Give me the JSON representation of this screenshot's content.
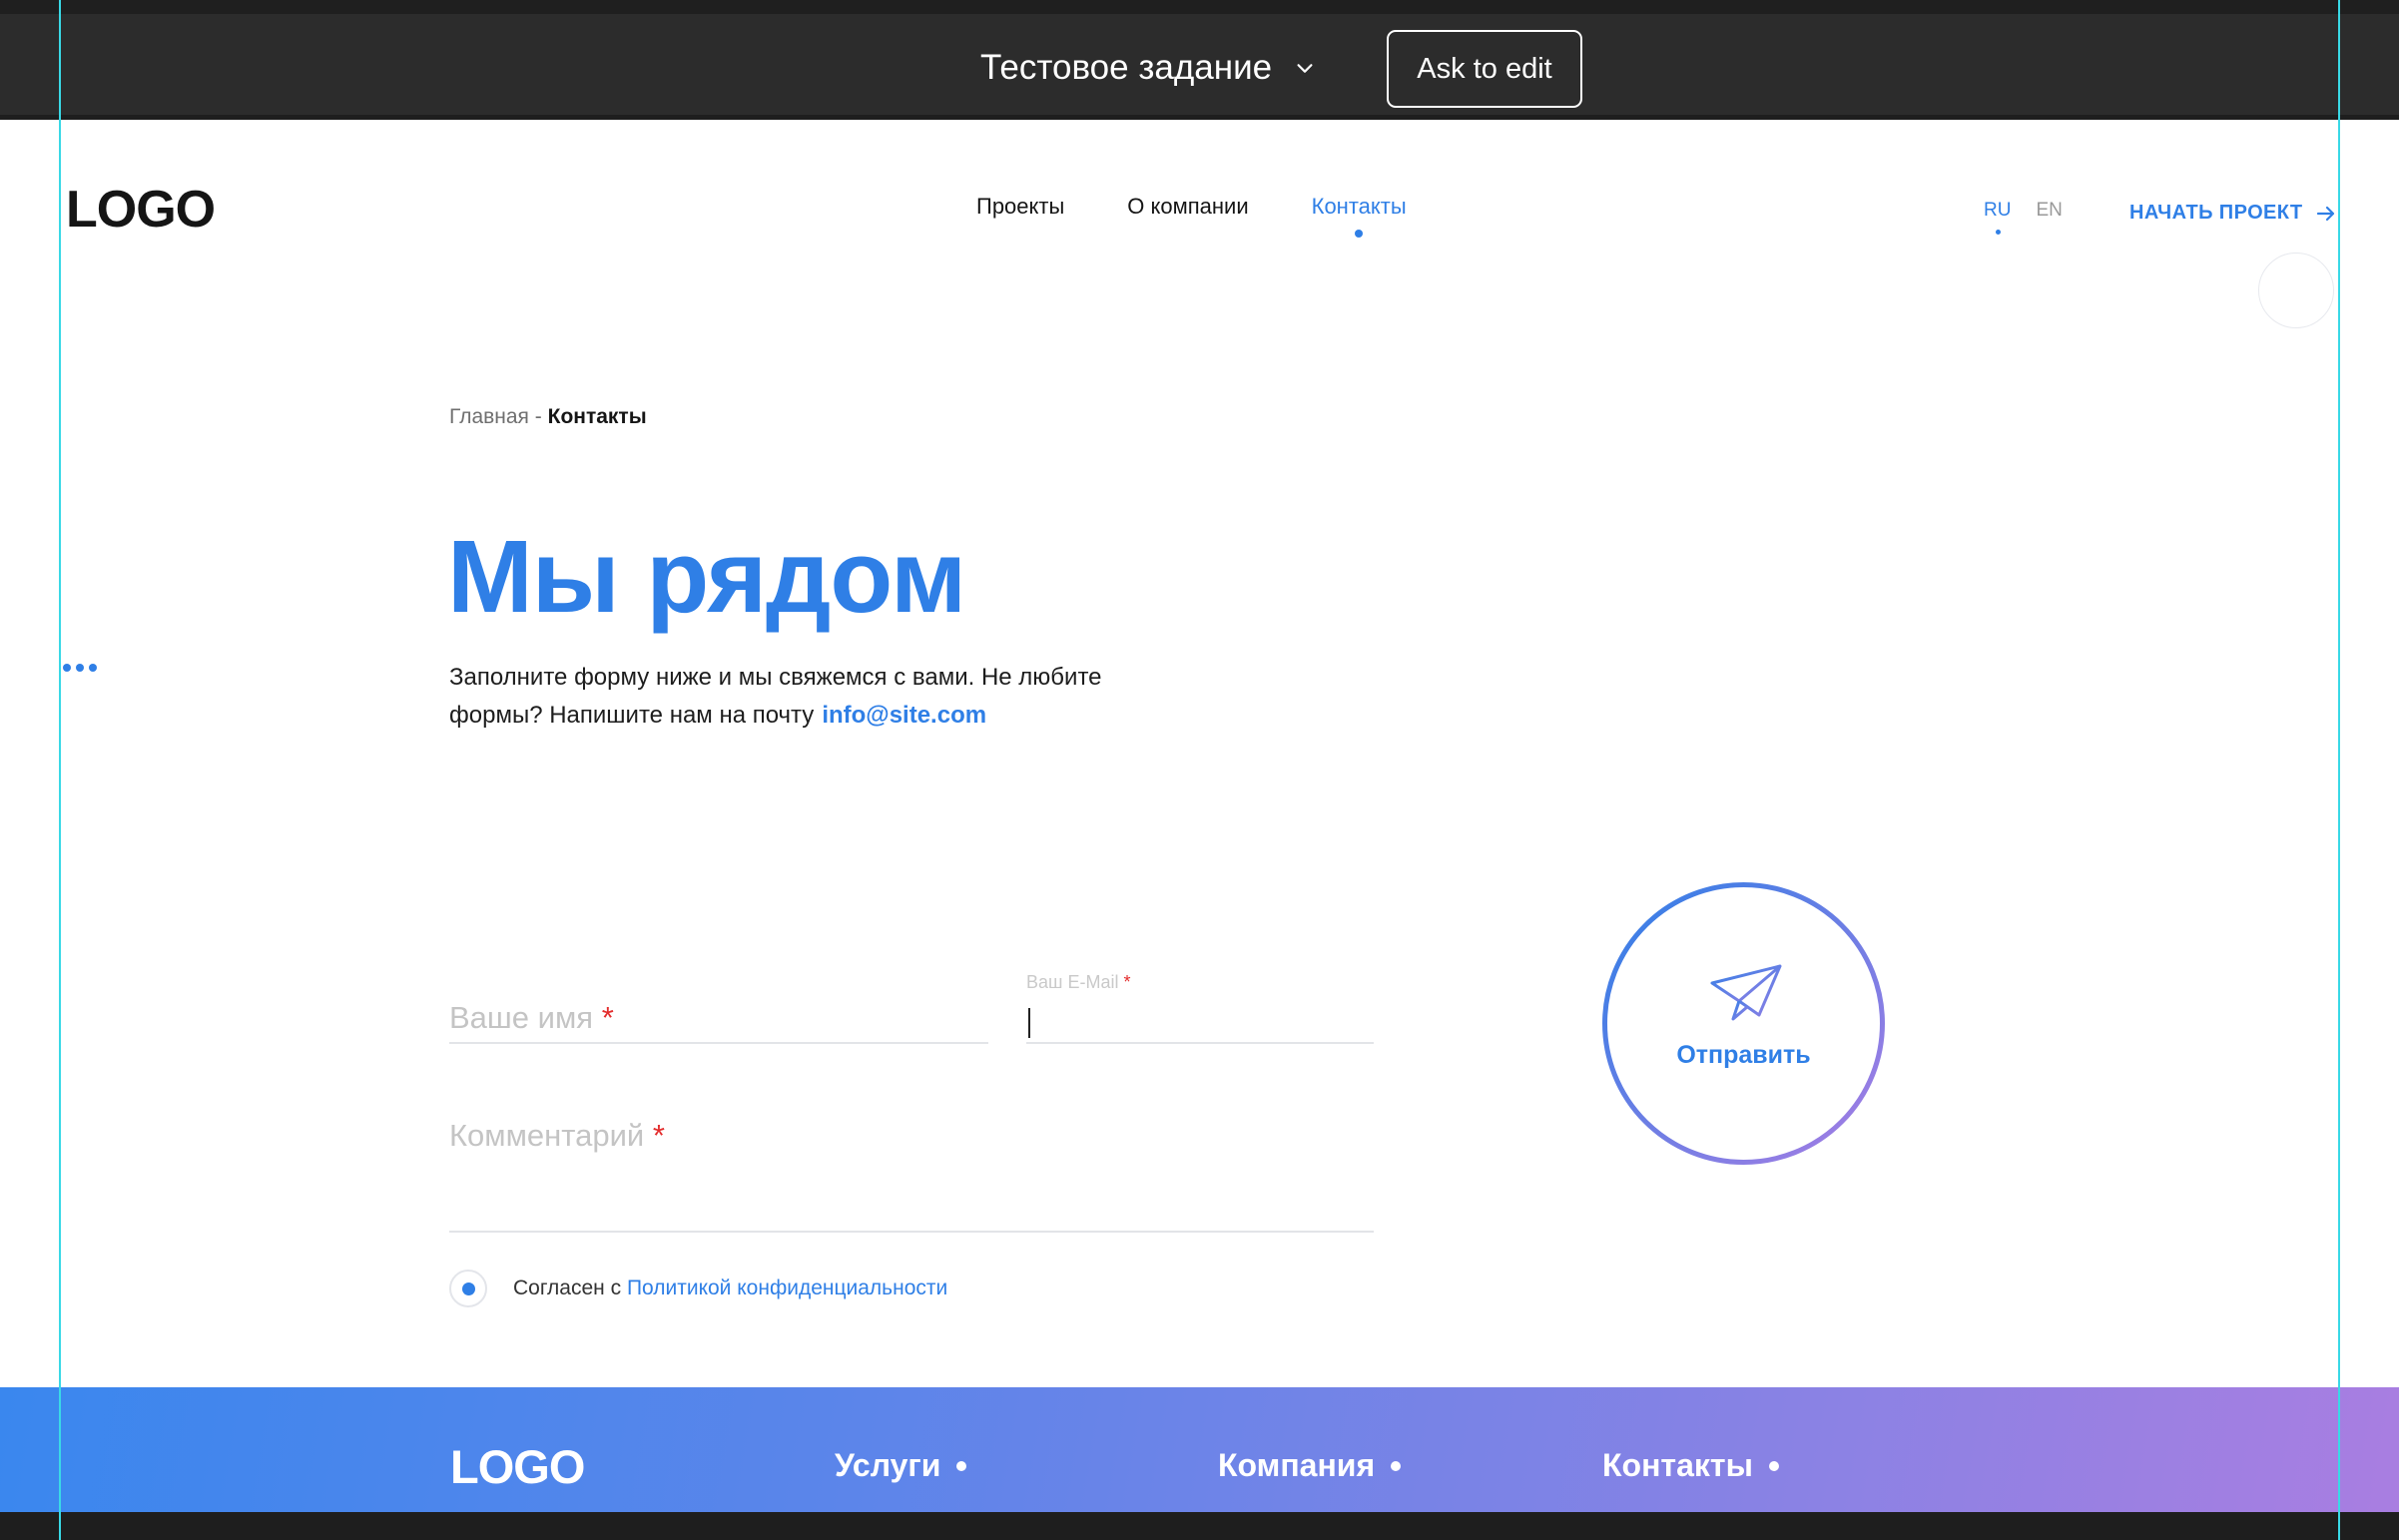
{
  "editor": {
    "file_title": "Тестовое задание",
    "ask_to_edit": "Ask to edit"
  },
  "header": {
    "logo": "LOGO",
    "nav": [
      {
        "label": "Проекты",
        "active": false
      },
      {
        "label": "О компании",
        "active": false
      },
      {
        "label": "Контакты",
        "active": true
      }
    ],
    "languages": [
      {
        "label": "RU",
        "active": true
      },
      {
        "label": "EN",
        "active": false
      }
    ],
    "cta": "НАЧАТЬ ПРОЕКТ"
  },
  "breadcrumb": {
    "home": "Главная",
    "separator": "-",
    "current": "Контакты"
  },
  "hero": {
    "title": "Мы рядом",
    "intro_line1": "Заполните форму ниже и мы свяжемся с вами. Не любите",
    "intro_line2": "формы? Напишите нам на почту",
    "email": "info@site.com"
  },
  "form": {
    "name_placeholder": "Ваше имя",
    "email_label": "Ваш E-Mail",
    "email_value": "",
    "comment_placeholder": "Комментарий",
    "required_mark": "*",
    "agree_prefix": "Согласен с",
    "agree_link": "Политикой конфиденциальности",
    "agree_checked": true,
    "submit": "Отправить"
  },
  "footer": {
    "logo": "LOGO",
    "items": [
      "Услуги",
      "Компания",
      "Контакты"
    ]
  },
  "colors": {
    "accent": "#2f7fe6",
    "required": "#e32d2d",
    "gradient_start": "#3a87ee",
    "gradient_end": "#a97ee1",
    "guide": "#39d9e6"
  }
}
